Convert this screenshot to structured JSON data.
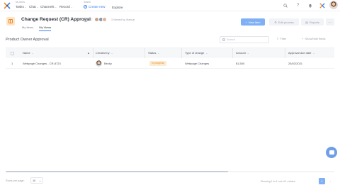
{
  "topnav": {
    "items_label": "My Items",
    "tasks": "Tasks",
    "chat": "Chat",
    "channels": "Channels",
    "record": "Record",
    "search_label": "Search",
    "create_new": "Create new",
    "explore": "Explore"
  },
  "app": {
    "title": "Change Request (CR) Approval",
    "members_text": "3 Viewed by, Manual",
    "tabs": [
      "My Items",
      "My Views"
    ],
    "active_tab_index": 1,
    "new_item": "New item",
    "edit_process": "Edit process",
    "reports": "Reports",
    "more": "..."
  },
  "toolbar": {
    "section_title": "Product Owner Approval",
    "search_placeholder": "Search",
    "filter": "Filter",
    "show_hide": "Show/hide fields"
  },
  "table": {
    "columns": [
      "Name",
      "Created by",
      "Status",
      "Type of change",
      "Amount",
      "Approval due date"
    ],
    "rows": [
      {
        "index": "1",
        "name": "Webpage Changes - CR-8723",
        "created_by": "Becky",
        "status": "In progress",
        "type_of_change": "Webpage Changes",
        "amount": "$1,500",
        "due_date": "25/02/2021"
      }
    ]
  },
  "footer": {
    "rows_per_page_label": "Rows per page:",
    "rows_per_page_value": "10",
    "showing": "Showing 1 to 1 out of 1 entries",
    "current_page": "1",
    "next": "›"
  },
  "colors": {
    "accent": "#3d7ef0",
    "button_primary": "#7fb0f5",
    "status_in_progress_bg": "#fdecd4",
    "status_in_progress_text": "#e8891c",
    "app_icon_bg": "#fde5c8"
  },
  "icons": {
    "logo": "app-logo",
    "search": "search-icon",
    "help": "help-icon",
    "notifications": "bell-icon",
    "chat": "chat-icon"
  }
}
